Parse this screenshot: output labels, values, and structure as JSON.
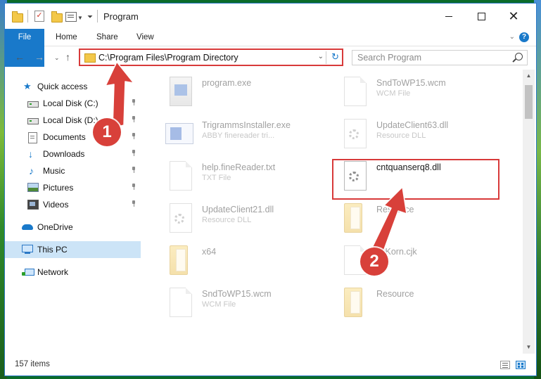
{
  "window": {
    "title": "Program"
  },
  "ribbon": {
    "tabs": [
      {
        "label": "File"
      },
      {
        "label": "Home"
      },
      {
        "label": "Share"
      },
      {
        "label": "View"
      }
    ],
    "help_label": "?"
  },
  "address_bar": {
    "path": "C:\\Program Files\\Program Directory"
  },
  "search": {
    "placeholder": "Search Program"
  },
  "nav_pane": {
    "quick_access": "Quick access",
    "items": [
      {
        "label": "Local Disk (C:)",
        "icon": "drive-icon"
      },
      {
        "label": "Local Disk (D:)",
        "icon": "drive-icon"
      },
      {
        "label": "Documents",
        "icon": "documents-icon"
      },
      {
        "label": "Downloads",
        "icon": "downloads-icon"
      },
      {
        "label": "Music",
        "icon": "music-icon"
      },
      {
        "label": "Pictures",
        "icon": "pictures-icon"
      },
      {
        "label": "Videos",
        "icon": "videos-icon"
      }
    ],
    "onedrive": "OneDrive",
    "this_pc": "This PC",
    "network": "Network"
  },
  "files": [
    {
      "name": "program.exe",
      "type": "",
      "icon": "exe-icon"
    },
    {
      "name": "SndToWP15.wcm",
      "type": "WCM File",
      "icon": "document-icon"
    },
    {
      "name": "TrigrammsInstaller.exe",
      "type": "ABBY finereader tri...",
      "icon": "installer-icon"
    },
    {
      "name": "UpdateClient63.dll",
      "type": "Resource DLL",
      "icon": "dll-icon"
    },
    {
      "name": "help.fineReader.txt",
      "type": "TXT File",
      "icon": "document-icon"
    },
    {
      "name": "cntquanserq8.dll",
      "type": "",
      "icon": "dll-icon"
    },
    {
      "name": "UpdateClient21.dll",
      "type": "Resource DLL",
      "icon": "dll-icon"
    },
    {
      "name": "Resource",
      "type": "",
      "icon": "folder-icon"
    },
    {
      "name": "x64",
      "type": "",
      "icon": "folder-icon"
    },
    {
      "name": "BrKorn.cjk",
      "type": "File",
      "icon": "document-icon"
    },
    {
      "name": "SndToWP15.wcm",
      "type": "WCM File",
      "icon": "document-icon"
    },
    {
      "name": "Resource",
      "type": "",
      "icon": "folder-icon"
    }
  ],
  "status": {
    "item_count": "157 items"
  },
  "annotations": {
    "step1": "1",
    "step2": "2",
    "color": "#d8403a"
  }
}
